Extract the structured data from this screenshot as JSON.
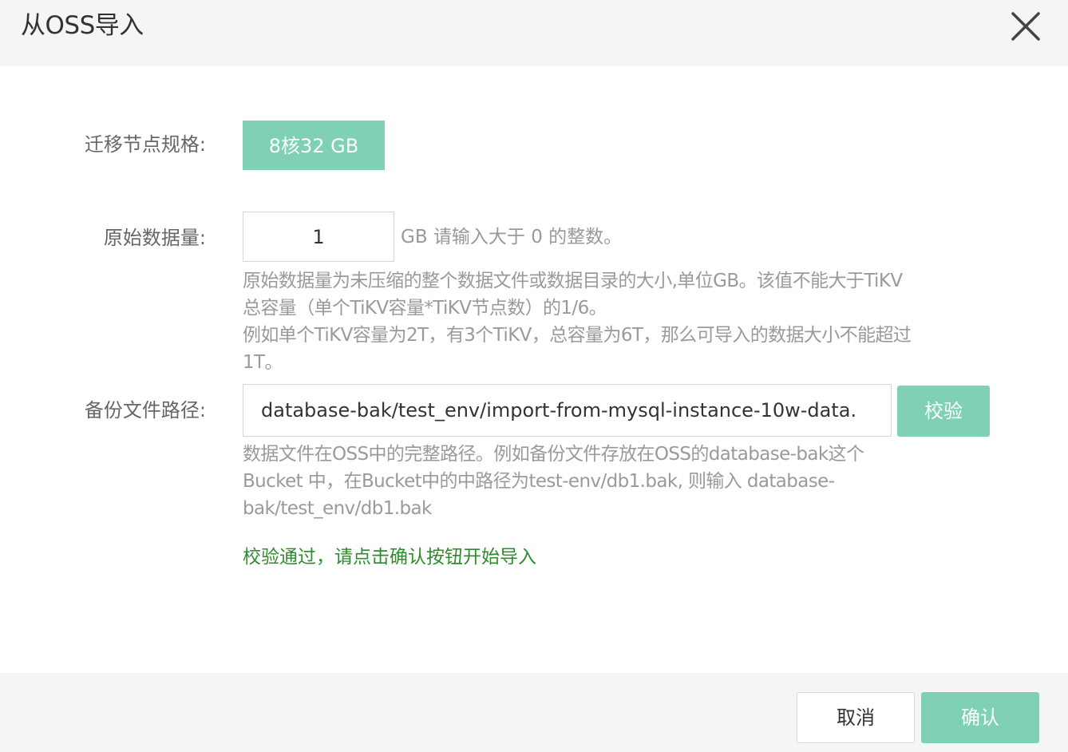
{
  "dialog": {
    "title": "从OSS导入",
    "close_icon": "close-icon"
  },
  "form": {
    "node_spec": {
      "label": "迁移节点规格:",
      "value": "8核32 GB"
    },
    "data_size": {
      "label": "原始数据量:",
      "value": "1",
      "unit_hint": "GB 请输入大于 0 的整数。",
      "help_lines": [
        "原始数据量为未压缩的整个数据文件或数据目录的大小,单位GB。该值不能大于TiKV",
        "总容量（单个TiKV容量*TiKV节点数）的1/6。",
        "例如单个TiKV容量为2T，有3个TiKV，总容量为6T，那么可导入的数据大小不能超过",
        "1T。"
      ]
    },
    "backup_path": {
      "label": "备份文件路径:",
      "value": "database-bak/test_env/import-from-mysql-instance-10w-data.",
      "verify_label": "校验",
      "help_lines": [
        "数据文件在OSS中的完整路径。例如备份文件存放在OSS的database-bak这个",
        "Bucket 中，在Bucket中的中路径为test-env/db1.bak, 则输入 database-",
        "bak/test_env/db1.bak"
      ]
    },
    "status_message": "校验通过，请点击确认按钮开始导入"
  },
  "footer": {
    "cancel_label": "取消",
    "confirm_label": "确认"
  },
  "colors": {
    "accent": "#7fd0b4",
    "success": "#2e8b2e",
    "header_bg": "#f4f5f7"
  }
}
